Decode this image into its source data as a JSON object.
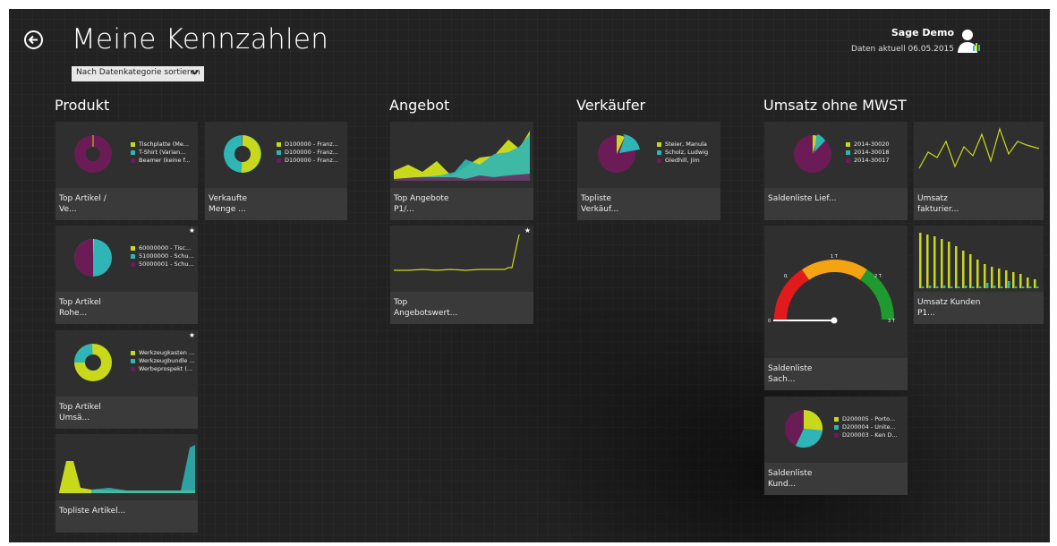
{
  "header": {
    "title": "Meine Kennzahlen",
    "sort_label": "Nach Datenkategorie sortieren",
    "user_name": "Sage Demo",
    "data_date": "Daten aktuell 06.05.2015"
  },
  "colors": {
    "yellow": "#c8d91c",
    "teal": "#2fb5b5",
    "purple": "#6b1c56",
    "tile": "#2f2f2f",
    "gauge_red": "#e11b1b",
    "gauge_orange": "#f4a312",
    "gauge_green": "#1e9a2f"
  },
  "groups": {
    "produkt": "Produkt",
    "angebot": "Angebot",
    "verkaeufer": "Verkäufer",
    "umsatz": "Umsatz ohne MWST"
  },
  "tiles": {
    "top_artikel_ve": {
      "label": "Top Artikel /\nVe...",
      "legend": [
        "Tischplatte (Me...",
        "T-Shirt (Varian...",
        "Beamer (keine f..."
      ],
      "chart_data": {
        "type": "pie",
        "labels": [
          "Tischplatte (Me...",
          "T-Shirt (Varian...",
          "Beamer (keine f..."
        ],
        "values": [
          1,
          0.5,
          98.5
        ]
      }
    },
    "verkaufte_menge": {
      "label": "Verkaufte\nMenge ...",
      "legend": [
        "D100000 - Franz...",
        "D100000 - Franz...",
        "D100000 - Franz..."
      ],
      "chart_data": {
        "type": "pie",
        "labels": [
          "D100000 - Franz...",
          "D100000 - Franz...",
          "D100000 - Franz..."
        ],
        "values": [
          50,
          47,
          3
        ]
      }
    },
    "top_artikel_rohe": {
      "label": "Top Artikel\nRohe...",
      "legend": [
        "60000000 - Tisc...",
        "51000000 - Schu...",
        "50000001 - Schu..."
      ],
      "chart_data": {
        "type": "pie",
        "labels": [
          "60000000 - Tisc...",
          "51000000 - Schu...",
          "50000001 - Schu..."
        ],
        "values": [
          1,
          49,
          50
        ]
      }
    },
    "top_artikel_umsa": {
      "label": "Top Artikel\nUmsä...",
      "legend": [
        "Werkzeugkasten ...",
        "Werkzeugbundle ...",
        "Werbeprospekt (..."
      ],
      "chart_data": {
        "type": "pie",
        "labels": [
          "Werkzeugkasten ...",
          "Werkzeugbundle ...",
          "Werbeprospekt (..."
        ],
        "values": [
          80,
          19,
          1
        ]
      }
    },
    "topliste_artikel": {
      "label": "Topliste Artikel...",
      "chart_data": {
        "type": "area",
        "series": [
          {
            "values": [
              2,
              25,
              3,
              2,
              1,
              1,
              1,
              1,
              1,
              1,
              1,
              1
            ]
          },
          {
            "values": [
              0,
              0,
              0,
              1,
              2,
              2,
              1,
              1,
              1,
              1,
              1,
              50
            ]
          }
        ]
      }
    },
    "top_angebote": {
      "label": "Top Angebote\nP1/...",
      "chart_data": {
        "type": "area",
        "series": [
          {
            "values": [
              10,
              18,
              12,
              22,
              8,
              16,
              25,
              30,
              38,
              32,
              40,
              36,
              60
            ]
          },
          {
            "values": [
              2,
              4,
              3,
              5,
              6,
              10,
              8,
              20,
              18,
              24,
              30,
              34,
              40
            ]
          }
        ]
      }
    },
    "top_angebotswert": {
      "label": "Top\nAngebotswert...",
      "chart_data": {
        "type": "line",
        "series": [
          {
            "values": [
              5,
              5.2,
              5.1,
              5.3,
              5.2,
              5.4,
              5.3,
              5.5,
              5.6,
              5.8,
              6.0,
              6.5,
              40
            ]
          }
        ]
      }
    },
    "topliste_verkaeufer": {
      "label": "Topliste\nVerkäuf...",
      "legend": [
        "Steier, Manula",
        "Scholz, Ludwig",
        "Gledhill, Jim"
      ],
      "chart_data": {
        "type": "pie",
        "labels": [
          "Steier, Manula",
          "Scholz, Ludwig",
          "Gledhill, Jim"
        ],
        "values": [
          7,
          16,
          77
        ]
      }
    },
    "saldenliste_lief": {
      "label": "Saldenliste Lief...",
      "legend": [
        "2014-30020",
        "2014-30018",
        "2014-30017"
      ],
      "chart_data": {
        "type": "pie",
        "labels": [
          "2014-30020",
          "2014-30018",
          "2014-30017"
        ],
        "values": [
          5,
          7,
          88
        ]
      }
    },
    "umsatz_fakturiert": {
      "label": "Umsatz\nfakturier...",
      "chart_data": {
        "type": "line",
        "series": [
          {
            "values": [
              4,
              20,
              12,
              34,
              6,
              28,
              16,
              36,
              8,
              40,
              14,
              30,
              26,
              22
            ]
          }
        ]
      }
    },
    "saldenliste_sach": {
      "label": "Saldenliste\nSach...",
      "gauge": {
        "tick_0": "0",
        "tick_0_half": "0,",
        "tick_1": "1 T",
        "tick_2": "2 T",
        "tick_3": "3 T",
        "value": 0
      },
      "chart_data": {
        "type": "gauge",
        "min": 0,
        "max": 3,
        "value": 0,
        "unit": "T",
        "ticks": [
          "0",
          "1 T",
          "2 T",
          "3 T"
        ]
      }
    },
    "umsatz_kunden": {
      "label": "Umsatz Kunden\nP1...",
      "chart_data": {
        "type": "bar",
        "series": [
          {
            "name": "s1",
            "values": [
              62,
              60,
              58,
              55,
              52,
              47,
              42,
              38,
              32,
              27,
              24,
              22,
              20,
              18,
              16,
              12,
              10
            ]
          },
          {
            "name": "s2",
            "values": [
              2,
              3,
              2,
              3,
              2,
              2,
              3,
              2,
              2,
              6,
              3,
              2,
              8,
              2,
              2,
              2,
              2
            ]
          }
        ]
      }
    },
    "saldenliste_kund": {
      "label": "Saldenliste\nKund...",
      "legend": [
        "D200005 - Porto...",
        "D200004 - Unite...",
        "D200003 - Ken D..."
      ],
      "chart_data": {
        "type": "pie",
        "labels": [
          "D200005 - Porto...",
          "D200004 - Unite...",
          "D200003 - Ken D..."
        ],
        "values": [
          30,
          30,
          40
        ]
      }
    }
  }
}
